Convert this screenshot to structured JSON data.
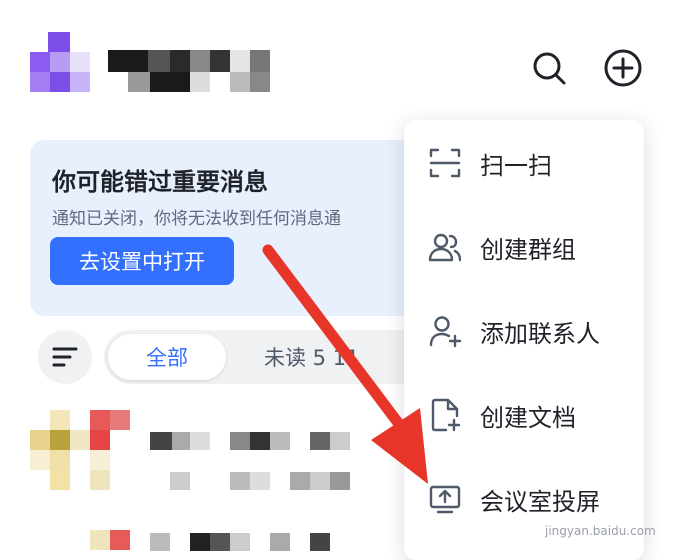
{
  "banner": {
    "title": "你可能错过重要消息",
    "description": "通知已关闭，你将无法收到任何消息通",
    "button_label": "去设置中打开"
  },
  "filter": {
    "tabs": [
      {
        "label": "全部",
        "selected": true
      },
      {
        "label": "未读 5 11",
        "selected": false
      }
    ]
  },
  "menu": {
    "items": [
      {
        "label": "扫一扫",
        "icon": "scan-icon"
      },
      {
        "label": "创建群组",
        "icon": "create-group-icon"
      },
      {
        "label": "添加联系人",
        "icon": "add-contact-icon"
      },
      {
        "label": "创建文档",
        "icon": "create-document-icon"
      },
      {
        "label": "会议室投屏",
        "icon": "screen-share-icon"
      }
    ]
  },
  "header": {
    "search_icon": "search-icon",
    "add_icon": "plus-circle-icon"
  },
  "colors": {
    "accent": "#3370ff",
    "banner_bg": "#e8f0fe",
    "arrow": "#e8352a"
  },
  "watermark": "jingyan.baidu.com"
}
